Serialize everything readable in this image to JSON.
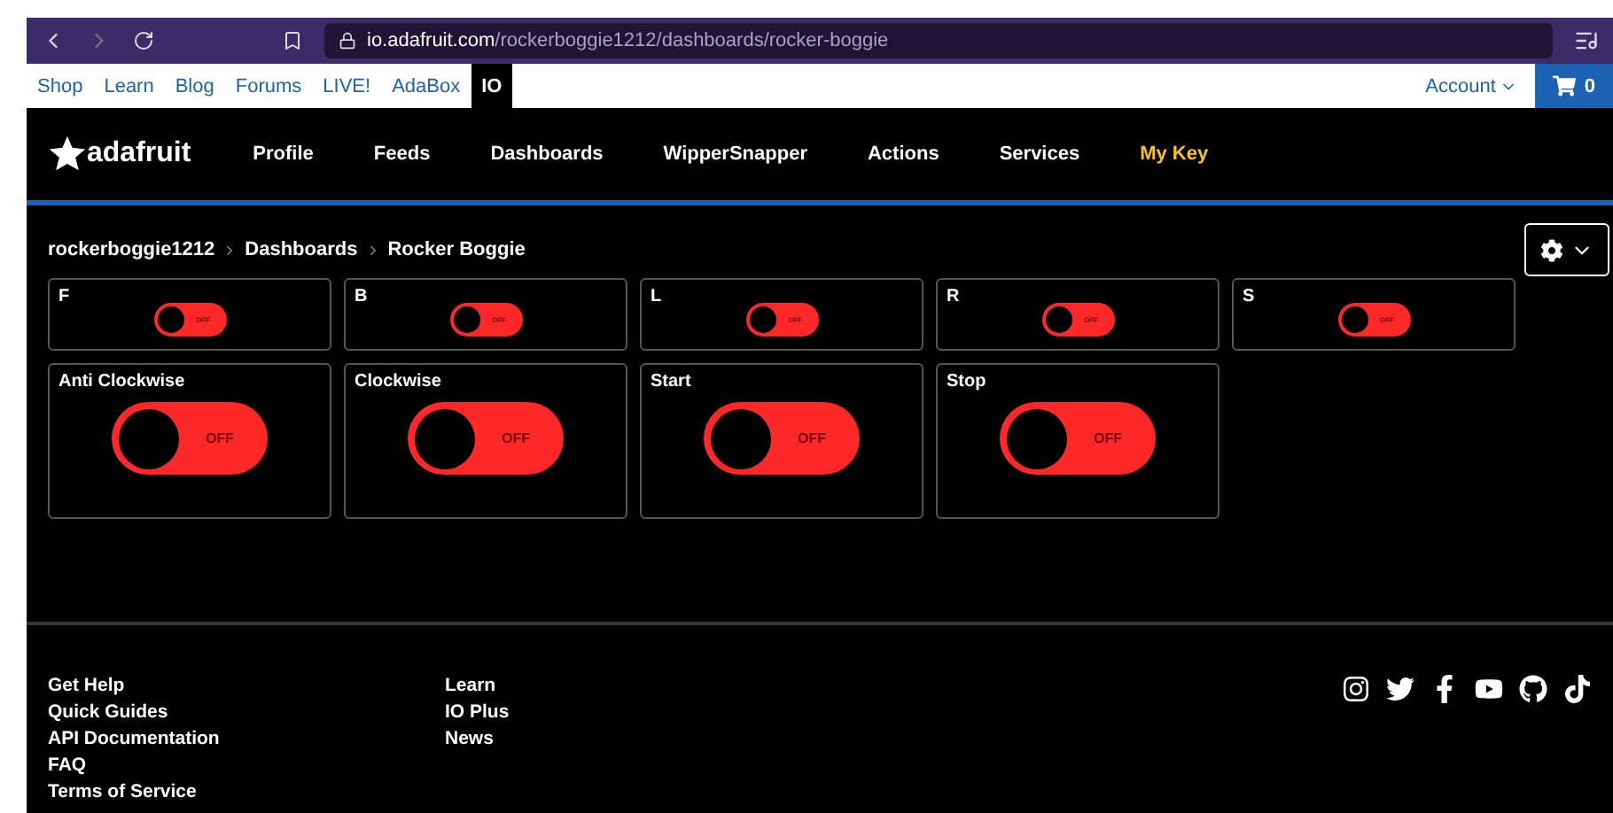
{
  "browser": {
    "url_host": "io.adafruit.com",
    "url_path": "/rockerboggie1212/dashboards/rocker-boggie"
  },
  "site_nav": {
    "links": [
      {
        "label": "Shop",
        "selected": false
      },
      {
        "label": "Learn",
        "selected": false
      },
      {
        "label": "Blog",
        "selected": false
      },
      {
        "label": "Forums",
        "selected": false
      },
      {
        "label": "LIVE!",
        "selected": false
      },
      {
        "label": "AdaBox",
        "selected": false
      },
      {
        "label": "IO",
        "selected": true
      }
    ],
    "account": "Account",
    "cart_count": "0"
  },
  "header": {
    "logo": "adafruit",
    "nav": [
      {
        "label": "Profile",
        "highlight": false
      },
      {
        "label": "Feeds",
        "highlight": false
      },
      {
        "label": "Dashboards",
        "highlight": false
      },
      {
        "label": "WipperSnapper",
        "highlight": false
      },
      {
        "label": "Actions",
        "highlight": false
      },
      {
        "label": "Services",
        "highlight": false
      },
      {
        "label": "My Key",
        "highlight": true
      }
    ]
  },
  "breadcrumb": [
    "rockerboggie1212",
    "Dashboards",
    "Rocker Boggie"
  ],
  "blocks_small": [
    {
      "title": "F",
      "on": false,
      "state_text": "OFF"
    },
    {
      "title": "B",
      "on": false,
      "state_text": "OFF"
    },
    {
      "title": "L",
      "on": false,
      "state_text": "OFF"
    },
    {
      "title": "R",
      "on": false,
      "state_text": "OFF"
    },
    {
      "title": "S",
      "on": false,
      "state_text": "OFF"
    }
  ],
  "blocks_large": [
    {
      "title": "Anti Clockwise",
      "on": false,
      "state_text": "OFF"
    },
    {
      "title": "Clockwise",
      "on": false,
      "state_text": "OFF"
    },
    {
      "title": "Start",
      "on": false,
      "state_text": "OFF"
    },
    {
      "title": "Stop",
      "on": false,
      "state_text": "OFF"
    }
  ],
  "footer": {
    "columns": [
      [
        "Get Help",
        "Quick Guides",
        "API Documentation",
        "FAQ",
        "Terms of Service"
      ],
      [
        "Learn",
        "IO Plus",
        "News"
      ]
    ]
  }
}
